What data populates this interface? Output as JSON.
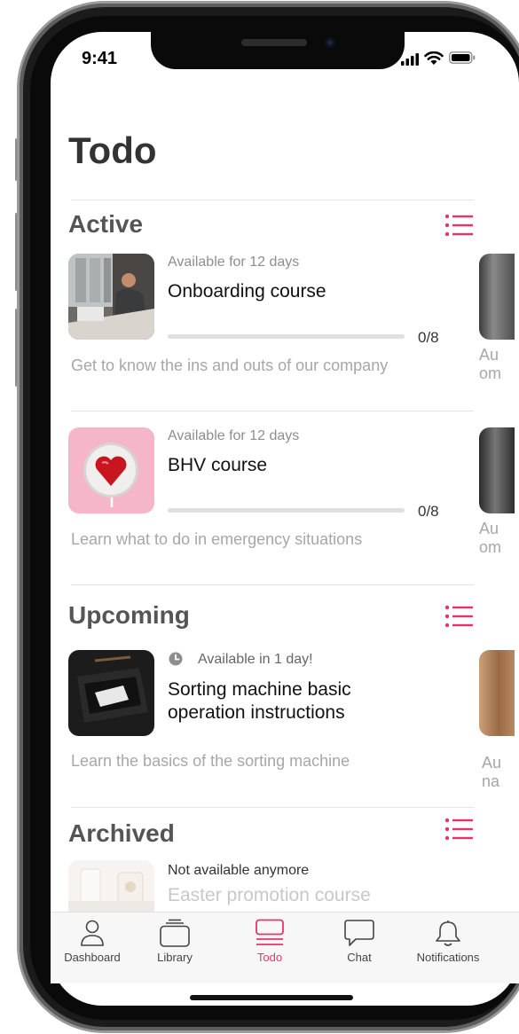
{
  "status_bar": {
    "time": "9:41"
  },
  "page": {
    "title": "Todo"
  },
  "sections": {
    "active": {
      "title": "Active",
      "courses": [
        {
          "availability": "Available for 12 days",
          "title": "Onboarding course",
          "progress": "0/8",
          "progress_fraction": 0,
          "description": "Get to know the ins and outs of our company",
          "peek_text": [
            "Au",
            "om"
          ]
        },
        {
          "availability": "Available for 12 days",
          "title": "BHV course",
          "progress": "0/8",
          "progress_fraction": 0,
          "description": "Learn what to do in emergency situations",
          "peek_text": [
            "Au",
            "om"
          ]
        }
      ]
    },
    "upcoming": {
      "title": "Upcoming",
      "courses": [
        {
          "availability": "Available in 1 day!",
          "title_line1": "Sorting machine basic",
          "title_line2": "operation instructions",
          "description": "Learn the basics of the sorting machine",
          "peek_text": [
            "Au",
            "na"
          ]
        }
      ]
    },
    "archived": {
      "title": "Archived",
      "courses": [
        {
          "availability": "Not available anymore",
          "title": "Easter promotion course"
        }
      ]
    }
  },
  "tab_bar": {
    "active_tab": "Todo",
    "items": [
      {
        "label": "Dashboard",
        "icon": "person-icon"
      },
      {
        "label": "Library",
        "icon": "library-icon"
      },
      {
        "label": "Todo",
        "icon": "todo-icon"
      },
      {
        "label": "Chat",
        "icon": "chat-icon"
      },
      {
        "label": "Notifications",
        "icon": "bell-icon"
      }
    ]
  },
  "colors": {
    "accent": "#e8336a",
    "text_dark": "#333333",
    "text_muted": "#a7a7a7"
  }
}
